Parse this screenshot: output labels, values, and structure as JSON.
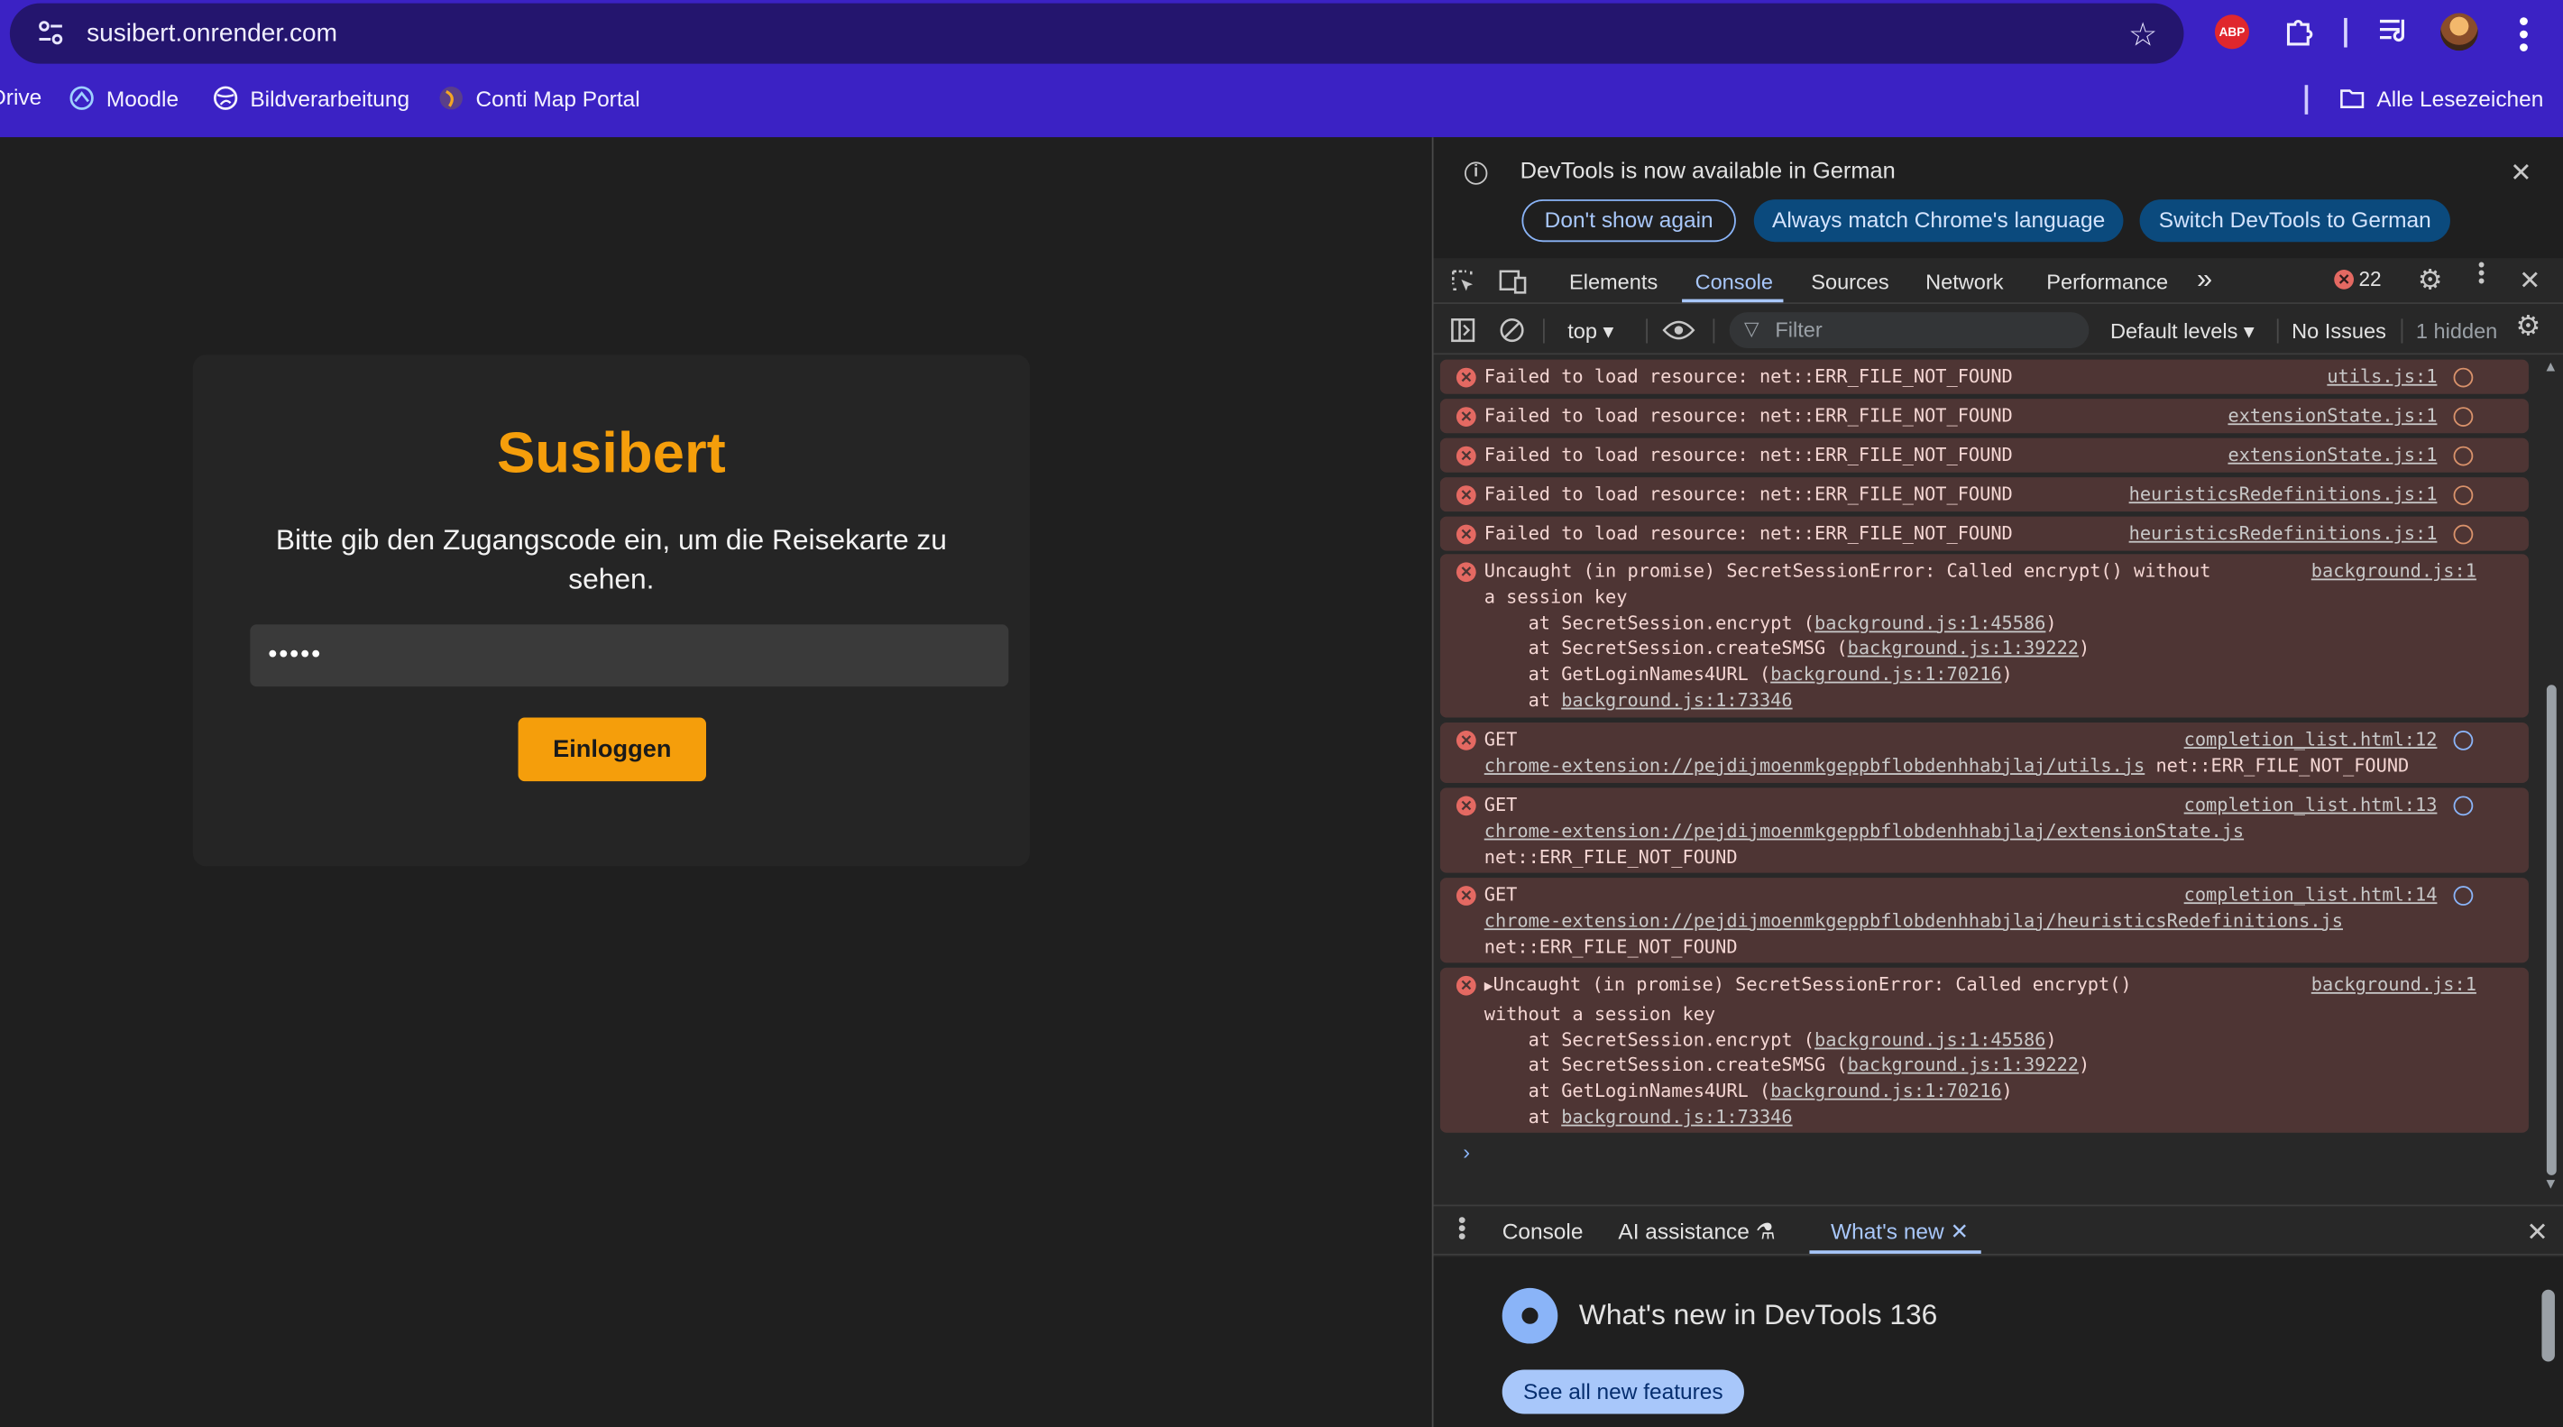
{
  "browser": {
    "url": "susibert.onrender.com",
    "abp_label": "ABP",
    "bookmarks": [
      {
        "label": "Drive"
      },
      {
        "label": "Moodle"
      },
      {
        "label": "Bildverarbeitung"
      },
      {
        "label": "Conti Map Portal"
      }
    ],
    "all_bookmarks": "Alle Lesezeichen"
  },
  "page": {
    "title": "Susibert",
    "prompt": "Bitte gib den Zugangscode ein, um die Reisekarte zu sehen.",
    "code_value": "•••••",
    "login_label": "Einloggen"
  },
  "devtools": {
    "banner": {
      "text": "DevTools is now available in German",
      "dont_show": "Don't show again",
      "always_match": "Always match Chrome's language",
      "switch": "Switch DevTools to German"
    },
    "tabs": [
      "Elements",
      "Console",
      "Sources",
      "Network",
      "Performance"
    ],
    "more_tabs": "»",
    "error_count": "22",
    "toolbar": {
      "context": "top ▾",
      "filter_placeholder": "Filter",
      "levels": "Default levels ▾",
      "issues": "No Issues",
      "hidden": "1 hidden"
    },
    "messages": [
      {
        "text": "Failed to load resource: net::ERR_FILE_NOT_FOUND",
        "src": "utils.js:1"
      },
      {
        "text": "Failed to load resource: net::ERR_FILE_NOT_FOUND",
        "src": "extensionState.js:1"
      },
      {
        "text": "Failed to load resource: net::ERR_FILE_NOT_FOUND",
        "src": "extensionState.js:1"
      },
      {
        "text": "Failed to load resource: net::ERR_FILE_NOT_FOUND",
        "src": "heuristicsRedefinitions.js:1"
      },
      {
        "text": "Failed to load resource: net::ERR_FILE_NOT_FOUND",
        "src": "heuristicsRedefinitions.js:1"
      }
    ],
    "uncaught1": {
      "line1": "Uncaught (in promise) SecretSessionError: Called encrypt() without",
      "line2": "a session key",
      "src": "background.js:1",
      "stack": [
        {
          "prefix": "    at SecretSession.encrypt (",
          "link": "background.js:1:45586",
          "suffix": ")"
        },
        {
          "prefix": "    at SecretSession.createSMSG (",
          "link": "background.js:1:39222",
          "suffix": ")"
        },
        {
          "prefix": "    at GetLoginNames4URL (",
          "link": "background.js:1:70216",
          "suffix": ")"
        },
        {
          "prefix": "    at ",
          "link": "background.js:1:73346",
          "suffix": ""
        }
      ]
    },
    "gets": [
      {
        "method": "GET",
        "url": "chrome-extension://pejdijmoenmkgeppbflobdenhhabjlaj/utils.js",
        "tail": " net::ERR_FILE_NOT_FOUND",
        "err": "",
        "src": "completion_list.html:12"
      },
      {
        "method": "GET",
        "url": "chrome-extension://pejdijmoenmkgeppbflobdenhhabjlaj/extensionState.js",
        "tail": "",
        "err": "net::ERR_FILE_NOT_FOUND",
        "src": "completion_list.html:13"
      },
      {
        "method": "GET",
        "url": "chrome-extension://pejdijmoenmkgeppbflobdenhhabjlaj/heuristicsRedefinitions.js",
        "tail": "",
        "err": "net::ERR_FILE_NOT_FOUND",
        "src": "completion_list.html:14"
      }
    ],
    "uncaught2": {
      "line1": "Uncaught (in promise) SecretSessionError: Called encrypt()",
      "line2": "without a session key",
      "src": "background.js:1",
      "stack": [
        {
          "prefix": "    at SecretSession.encrypt (",
          "link": "background.js:1:45586",
          "suffix": ")"
        },
        {
          "prefix": "    at SecretSession.createSMSG (",
          "link": "background.js:1:39222",
          "suffix": ")"
        },
        {
          "prefix": "    at GetLoginNames4URL (",
          "link": "background.js:1:70216",
          "suffix": ")"
        },
        {
          "prefix": "    at ",
          "link": "background.js:1:73346",
          "suffix": ""
        }
      ]
    },
    "drawer": {
      "tabs": [
        "Console",
        "AI assistance",
        "What's new"
      ],
      "whats_new_title": "What's new in DevTools 136",
      "see_all": "See all new features"
    }
  }
}
